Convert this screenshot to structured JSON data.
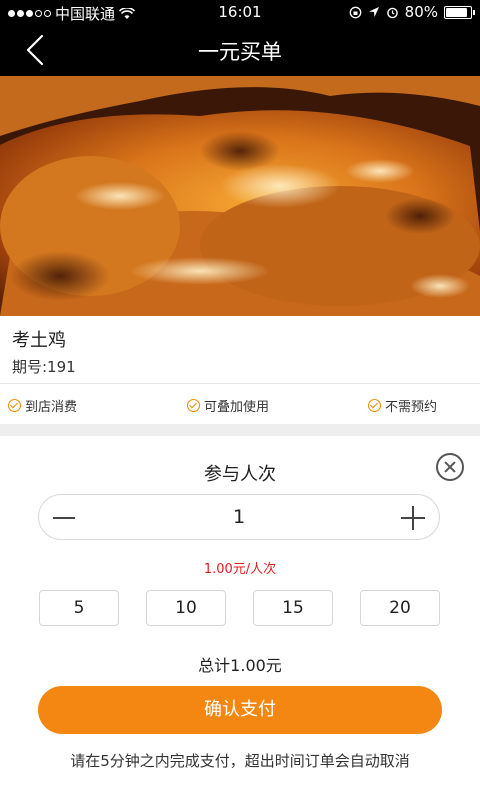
{
  "status": {
    "carrier": "中国联通",
    "time": "16:01",
    "battery": "80%",
    "battery_level": 0.8
  },
  "nav": {
    "title": "一元买单"
  },
  "product": {
    "name": "考土鸡",
    "issue": "期号:191"
  },
  "features": [
    "到店消费",
    "可叠加使用",
    "不需预约"
  ],
  "purchase": {
    "title": "参与人次",
    "quantity": "1",
    "unit_price": "1.00元/人次",
    "quick_options": [
      "5",
      "10",
      "15",
      "20"
    ],
    "total": "总计1.00元",
    "pay_label": "确认支付",
    "notice": "请在5分钟之内完成支付，超出时间订单会自动取消"
  },
  "colors": {
    "accent": "#f38712",
    "price": "#e02020"
  }
}
